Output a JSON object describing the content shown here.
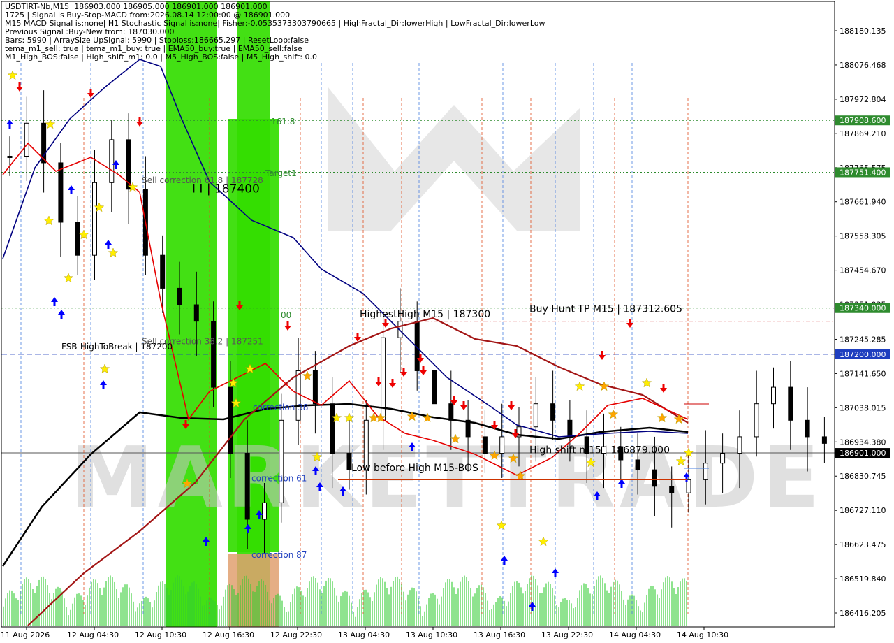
{
  "window": {
    "symbol": "USDTIRT-Nb,M15",
    "ohlc": "186903.000 186905.000 186901.000 186901.000"
  },
  "info_lines": [
    "1725 | Signal is Buy-Stop-MACD from:2026.08.14 12:00:00 @ 186901.000",
    "M15 MACD Signal is:none| H1 Stochastic Signal is:none| Fisher:-0.0535373303790665 | HighFractal_Dir:lowerHigh | LowFractal_Dir:lowerLow",
    "Previous Signal :Buy-New from: 187030.000",
    "Bars: 5990 | ArraySize UpSignal: 5990 | Stoploss:186665.297 | ResetLoop:false",
    "tema_m1_sell: true | tema_m1_buy: true | EMA50_buy:true | EMA50_sell:false",
    "M1_High_BOS:false | High_shift_m1: 0.0 | M5_High_BOS:false | M5_High_shift: 0.0"
  ],
  "chart_data": {
    "type": "candlestick",
    "symbol": "USDTIRT-Nb",
    "timeframe": "M15",
    "y_ticks": [
      "188180.135",
      "188076.468",
      "187972.804",
      "187869.210",
      "187765.575",
      "187661.940",
      "187558.305",
      "187454.670",
      "187351.035",
      "187245.285",
      "187141.650",
      "187038.015",
      "186934.380",
      "186830.745",
      "186727.110",
      "186623.475",
      "186519.840",
      "186416.205"
    ],
    "ylim": [
      186392,
      188250
    ],
    "x_ticks": [
      "11 Aug 2026",
      "12 Aug 04:30",
      "12 Aug 10:30",
      "12 Aug 16:30",
      "12 Aug 22:30",
      "13 Aug 04:30",
      "13 Aug 10:30",
      "13 Aug 16:30",
      "13 Aug 22:30",
      "14 Aug 04:30",
      "14 Aug 10:30"
    ],
    "price_boxes": [
      {
        "label": "187908.600",
        "value": 187908.6,
        "color": "#2e8b2e"
      },
      {
        "label": "187751.400",
        "value": 187751.4,
        "color": "#2e8b2e"
      },
      {
        "label": "187340.000",
        "value": 187340.0,
        "color": "#2e8b2e"
      },
      {
        "label": "187200.000",
        "value": 187200.0,
        "color": "#1f3fbf"
      },
      {
        "label": "186901.000",
        "value": 186901.0,
        "color": "#000000"
      }
    ],
    "hlines": [
      {
        "value": 187908.6,
        "color": "#2e8b2e",
        "dash": "2,3"
      },
      {
        "value": 187751.4,
        "color": "#2e8b2e",
        "dash": "2,3"
      },
      {
        "value": 187340.0,
        "color": "#2e8b2e",
        "dash": "2,3"
      },
      {
        "value": 187200.0,
        "color": "#1f3fbf",
        "dash": "8,4"
      },
      {
        "value": 187300.0,
        "color": "#cc0000",
        "dash": "6,3,2,3"
      },
      {
        "value": 186901.0,
        "color": "#555555",
        "dash": "1,0"
      }
    ],
    "annotations": [
      {
        "text": "161.8",
        "value": 187896,
        "color": "#2e8b2e"
      },
      {
        "text": "Target1",
        "value": 187740,
        "color": "#2e8b2e"
      },
      {
        "text": "Sell correction 61.8 | 187728",
        "value": 187718,
        "color": "#555555"
      },
      {
        "text": "I I | 187400",
        "value": 187690,
        "color": "#000000"
      },
      {
        "text": "HighestHigh   M15 | 187300",
        "value": 187312,
        "color": "#000000"
      },
      {
        "text": "Buy Hunt TP M15 | 187312.605",
        "value": 187328,
        "color": "#000000"
      },
      {
        "text": "FSB-HighToBreak | 187200",
        "value": 187215,
        "color": "#000000"
      },
      {
        "text": "Sell correction 38.2 | 187251",
        "value": 187230,
        "color": "#555555"
      },
      {
        "text": "correction 38",
        "value": 187030,
        "color": "#1f3fbf"
      },
      {
        "text": "High shift m15 | 186879.000",
        "value": 186900,
        "color": "#000000"
      },
      {
        "text": "Low before High   M15-BOS",
        "value": 186846,
        "color": "#000000"
      },
      {
        "text": "correction 61",
        "value": 186815,
        "color": "#1f3fbf"
      },
      {
        "text": "correction 87",
        "value": 186583,
        "color": "#1f3fbf"
      },
      {
        "text": "00",
        "value": 187310,
        "color": "#2e8b2e"
      }
    ],
    "watermark": "MARKETTRADE",
    "colors": {
      "candle_up": "#000000",
      "candle_down": "#000000",
      "ema_red": "#e60000",
      "ema_dark_red": "#a31515",
      "ema_navy": "#000080",
      "ema_black": "#000000",
      "zone_green": "#33dd00",
      "zone_orange": "#e0a070",
      "volume": "#33cc33",
      "arrow_up": "#0000ff",
      "arrow_down": "#ee0000",
      "star_yellow": "#ffee00",
      "star_orange": "#ffa500"
    }
  }
}
